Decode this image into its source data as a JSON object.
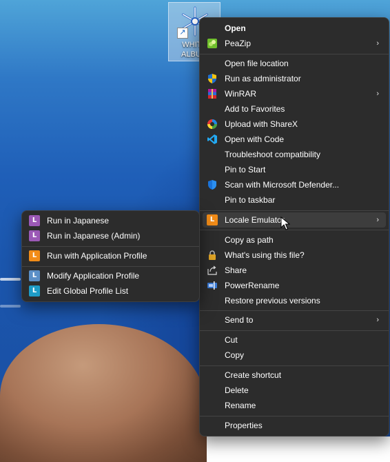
{
  "desktop_icon": {
    "label": "WHITE ALBUM"
  },
  "main_menu": {
    "items": [
      {
        "label": "Open",
        "icon": "none",
        "bold": true
      },
      {
        "label": "PeaZip",
        "icon": "peazip-icon",
        "submenu": true
      },
      {
        "label": "Open file location",
        "icon": "none"
      },
      {
        "label": "Run as administrator",
        "icon": "uac-shield-icon"
      },
      {
        "label": "WinRAR",
        "icon": "winrar-icon",
        "submenu": true
      },
      {
        "label": "Add to Favorites",
        "icon": "none"
      },
      {
        "label": "Upload with ShareX",
        "icon": "sharex-icon"
      },
      {
        "label": "Open with Code",
        "icon": "vscode-icon"
      },
      {
        "label": "Troubleshoot compatibility",
        "icon": "none"
      },
      {
        "label": "Pin to Start",
        "icon": "none"
      },
      {
        "label": "Scan with Microsoft Defender...",
        "icon": "defender-icon"
      },
      {
        "label": "Pin to taskbar",
        "icon": "none"
      },
      {
        "label": "Locale Emulator",
        "icon": "locale-emulator-icon",
        "submenu": true,
        "highlighted": true
      },
      {
        "label": "Copy as path",
        "icon": "none"
      },
      {
        "label": "What's using this file?",
        "icon": "lock-icon"
      },
      {
        "label": "Share",
        "icon": "share-icon"
      },
      {
        "label": "PowerRename",
        "icon": "powerrename-icon"
      },
      {
        "label": "Restore previous versions",
        "icon": "none"
      },
      {
        "label": "Send to",
        "icon": "none",
        "submenu": true
      },
      {
        "label": "Cut",
        "icon": "none"
      },
      {
        "label": "Copy",
        "icon": "none"
      },
      {
        "label": "Create shortcut",
        "icon": "none"
      },
      {
        "label": "Delete",
        "icon": "none"
      },
      {
        "label": "Rename",
        "icon": "none"
      },
      {
        "label": "Properties",
        "icon": "none"
      }
    ]
  },
  "sub_menu": {
    "items": [
      {
        "label": "Run in Japanese",
        "icon": "le-purple-icon",
        "letter": "L",
        "color": "#9b59b6"
      },
      {
        "label": "Run in Japanese (Admin)",
        "icon": "le-purple-icon",
        "letter": "L",
        "color": "#9b59b6"
      },
      {
        "label": "Run with Application Profile",
        "icon": "le-orange-icon",
        "letter": "L",
        "color": "#f28c18"
      },
      {
        "label": "Modify Application Profile",
        "icon": "le-blue-icon",
        "letter": "L",
        "color": "#5b8fc7"
      },
      {
        "label": "Edit Global Profile List",
        "icon": "le-teal-icon",
        "letter": "L",
        "color": "#1e9bc6"
      }
    ]
  },
  "chevron_glyph": "›",
  "colors": {
    "menu_bg": "#2c2c2c",
    "highlight": "#3d3d3d",
    "separator": "#444444"
  }
}
